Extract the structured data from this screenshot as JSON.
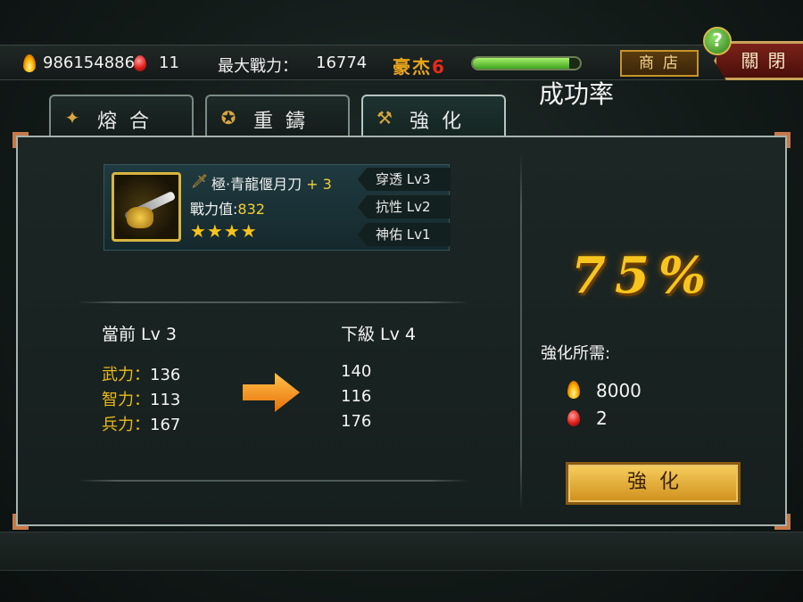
{
  "topbar": {
    "gold": "986154886",
    "gems": "11",
    "max_power_label": "最大戰力：",
    "max_power_value": "16774",
    "rank_title": "豪杰",
    "rank_level": "6",
    "exp_progress": 0.9,
    "shop_label": "商店",
    "close_label": "關閉"
  },
  "tabs": [
    {
      "label": "熔合",
      "active": false,
      "icon": "fusion-icon"
    },
    {
      "label": "重鑄",
      "active": false,
      "icon": "recast-icon"
    },
    {
      "label": "強化",
      "active": true,
      "icon": "enhance-icon"
    }
  ],
  "item": {
    "name": "極·青龍偃月刀",
    "plus": "+ 3",
    "power_label": "戰力值:",
    "power_value": "832",
    "stars": "★★★★",
    "star_count": 4,
    "attributes": [
      {
        "label": "穿透 Lv3"
      },
      {
        "label": "抗性 Lv2"
      },
      {
        "label": "神佑 Lv1"
      }
    ]
  },
  "current": {
    "level_label": "當前 Lv 3",
    "stats": [
      {
        "name": "武力：",
        "value": "136"
      },
      {
        "name": "智力：",
        "value": "113"
      },
      {
        "name": "兵力：",
        "value": "167"
      }
    ]
  },
  "next": {
    "level_label": "下級 Lv 4",
    "values": [
      "140",
      "116",
      "176"
    ]
  },
  "success": {
    "label": "成功率",
    "value": "75%"
  },
  "requirements": {
    "label": "強化所需:",
    "gold": "8000",
    "gems": "2"
  },
  "enhance_button": "強化",
  "colors": {
    "accent_gold": "#f2cf36",
    "stat_name": "#e9b91d",
    "rank_red": "#e62a1a"
  }
}
